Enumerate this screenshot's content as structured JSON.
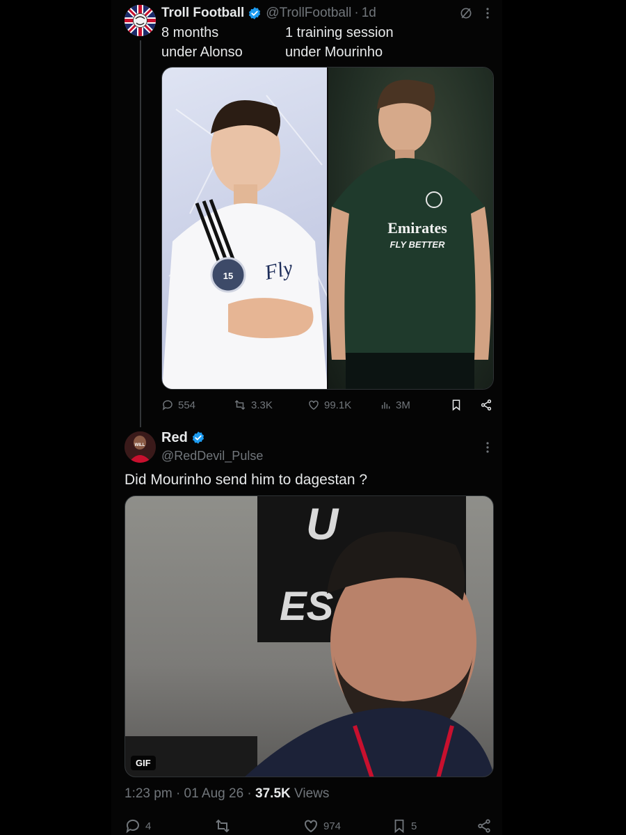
{
  "parent_tweet": {
    "author_name": "Troll Football",
    "handle": "@TrollFootball",
    "separator": "·",
    "age": "1d",
    "text_left": "8 months\nunder Alonso",
    "text_right": "1 training session\nunder Mourinho",
    "image_left": {
      "badge_number": "15",
      "sponsor": "Fly"
    },
    "image_right": {
      "sponsor_line1": "Emirates",
      "sponsor_line2": "FLY BETTER"
    },
    "stats": {
      "replies": "554",
      "reposts": "3.3K",
      "likes": "99.1K",
      "views": "3M"
    }
  },
  "reply_tweet": {
    "author_name": "Red",
    "avatar_text": "WILL",
    "handle": "@RedDevil_Pulse",
    "text": "Did Mourinho send him to dagestan ?",
    "media": {
      "gif_label": "GIF",
      "bg_logo_top": "U",
      "bg_logo_mid": "ES"
    },
    "time": "1:23 pm",
    "dot": "·",
    "date": "01 Aug 26",
    "views_count": "37.5K",
    "views_label": "Views",
    "stats": {
      "replies": "4",
      "likes": "974",
      "bookmarks": "5"
    }
  },
  "colors": {
    "background": "#000000",
    "text_primary": "#e7e9ea",
    "text_muted": "#71767b",
    "verified_blue": "#1d9bf0"
  },
  "icons": [
    "grok-icon",
    "more-icon",
    "verified-icon",
    "reply-icon",
    "repost-icon",
    "like-icon",
    "views-icon",
    "bookmark-icon",
    "share-icon"
  ]
}
